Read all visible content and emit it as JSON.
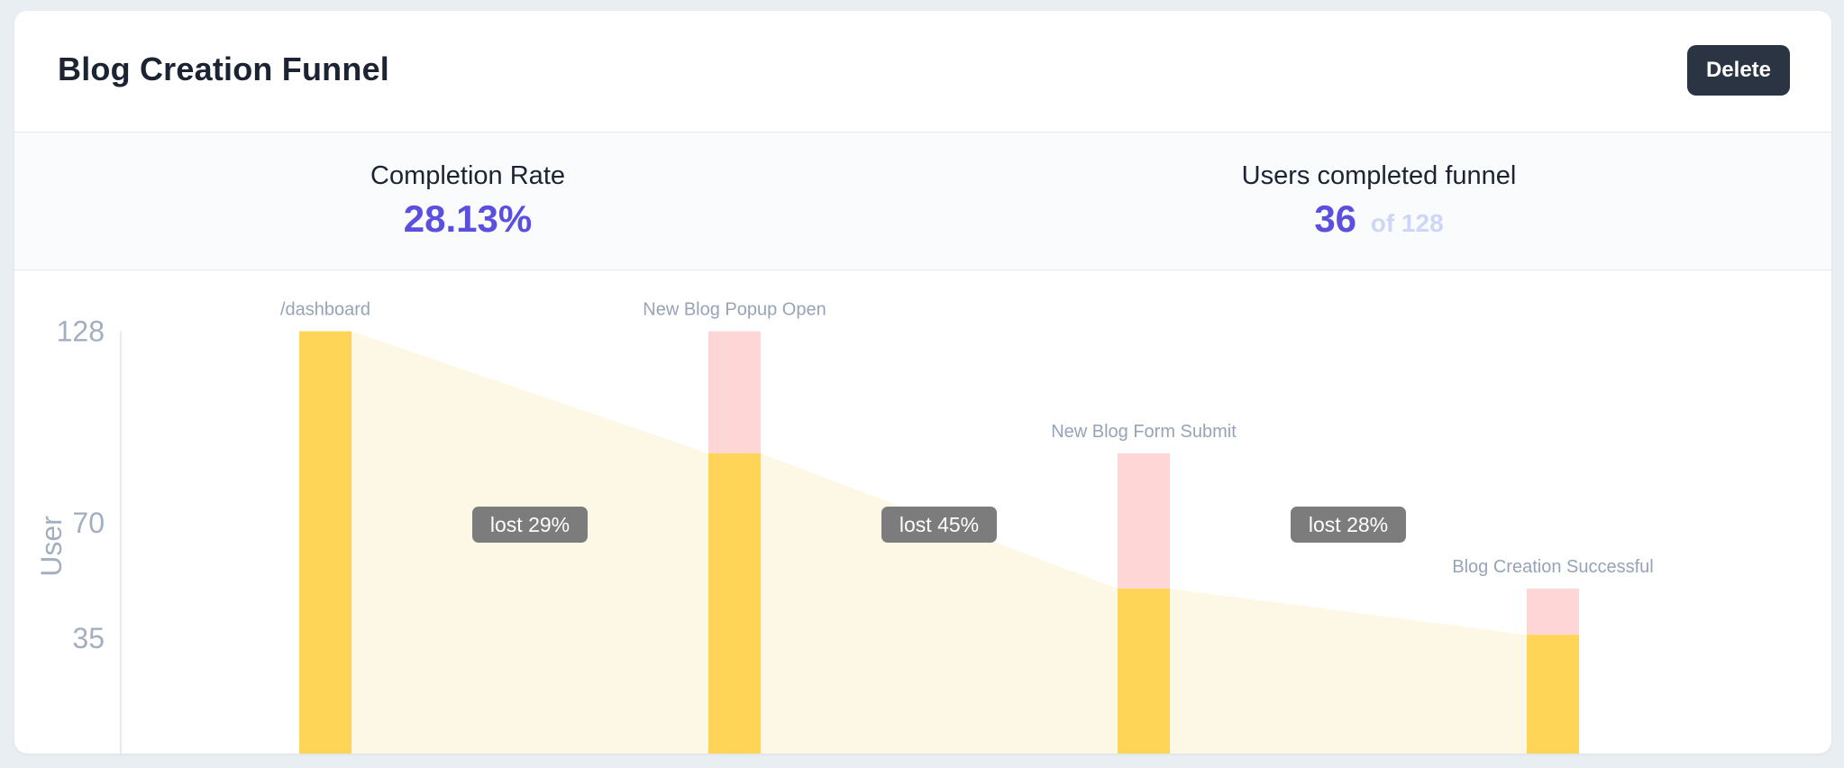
{
  "header": {
    "title": "Blog Creation Funnel",
    "delete_label": "Delete"
  },
  "stats": {
    "completion": {
      "label": "Completion Rate",
      "value": "28.13%"
    },
    "completed": {
      "label": "Users completed funnel",
      "value": "36",
      "total": "of 128"
    }
  },
  "colors": {
    "bar": "#ffd558",
    "dropoff": "#ffd6d6",
    "flow": "#fdf8e6",
    "accent": "#5b4fe0",
    "badge": "#7c7c7c"
  },
  "chart_data": {
    "type": "bar",
    "ylabel": "User",
    "ylim": [
      0,
      128
    ],
    "yticks": [
      35,
      70,
      128
    ],
    "categories": [
      "/dashboard",
      "New Blog Popup Open",
      "New Blog Form Submit",
      "Blog Creation Successful"
    ],
    "values": [
      128,
      91,
      50,
      36
    ],
    "lost": [
      "lost 29%",
      "lost 45%",
      "lost 28%"
    ]
  }
}
